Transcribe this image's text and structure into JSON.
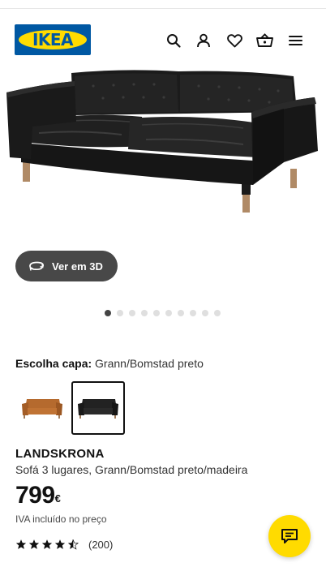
{
  "header": {
    "logo_text": "IKEA",
    "icons": [
      "search-icon",
      "user-icon",
      "heart-icon",
      "basket-icon",
      "menu-icon"
    ]
  },
  "gallery": {
    "view_3d_label": "Ver em 3D",
    "dot_count": 10,
    "active_dot": 1
  },
  "cover": {
    "label": "Escolha capa:",
    "value": "Grann/Bomstad preto",
    "options": [
      "Grann/Bomstad castanho-dourado",
      "Grann/Bomstad preto"
    ],
    "selected_index": 1
  },
  "product": {
    "name": "LANDSKRONA",
    "description": "Sofá 3 lugares, Grann/Bomstad preto/madeira",
    "price": "799",
    "currency": "€",
    "vat_note": "IVA incluído no preço",
    "rating": 4.5,
    "review_count": "(200)"
  },
  "colors": {
    "ikea_blue": "#0058a3",
    "ikea_yellow": "#ffdb00",
    "pill_bg": "#484848"
  }
}
